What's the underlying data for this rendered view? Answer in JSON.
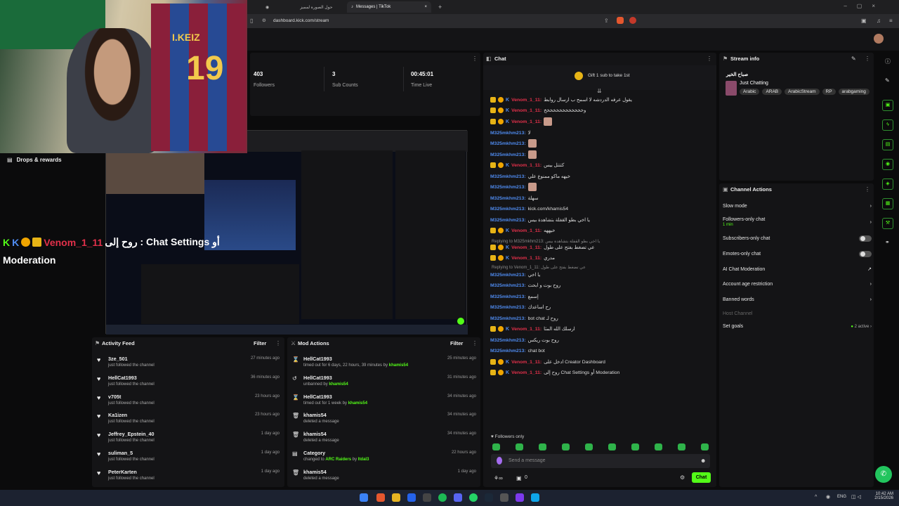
{
  "browser": {
    "tabs": [
      {
        "label": "حول الصورة لمميز"
      },
      {
        "label": "Messages | TikTok"
      }
    ],
    "url": "dashboard.kick.com/stream",
    "time": "10:42 AM",
    "date": "2/15/2026",
    "lang": "ENG"
  },
  "stats": {
    "followers_value": "403",
    "followers_label": "Followers",
    "subs_value": "3",
    "subs_label": "Sub Counts",
    "time_value": "00:45:01",
    "time_label": "Time Live"
  },
  "overlay": {
    "drops": "Drops & rewards",
    "big_user": "Venom_1_11",
    "big_msg": "روح إلى : Chat Settings أو",
    "moderation": "Moderation"
  },
  "chat": {
    "title": "Chat",
    "gift_text": "Gift 1 sub to take 1st",
    "followers_only": "Followers only",
    "send_placeholder": "Send a message",
    "send_button": "Chat",
    "counter": "0",
    "messages": [
      {
        "user": "Venom_1_11:",
        "type": "red",
        "text": "يقول عرفه الدردشه لا اسمح ب ارسال روابط"
      },
      {
        "user": "Venom_1_11:",
        "type": "red",
        "text": "وخخخخخخخخخخخخخ"
      },
      {
        "user": "Venom_1_11:",
        "type": "red",
        "text": "",
        "emote": true
      },
      {
        "user": "M325mkhm213:",
        "type": "blue",
        "text": "لا"
      },
      {
        "user": "M325mkhm213:",
        "type": "blue",
        "text": "",
        "emote": true
      },
      {
        "user": "M325mkhm213:",
        "type": "blue",
        "text": "",
        "emote": true
      },
      {
        "user": "Venom_1_11:",
        "type": "red",
        "text": "كتتتل بيس"
      },
      {
        "user": "M325mkhm213:",
        "type": "blue",
        "text": "خيهه ماكو ممنوع علي"
      },
      {
        "user": "M325mkhm213:",
        "type": "blue",
        "text": "",
        "emote": true
      },
      {
        "user": "M325mkhm213:",
        "type": "blue",
        "text": "سهلة"
      },
      {
        "user": "M325mkhm213:",
        "type": "blue",
        "text": "kick.com/khamis54"
      },
      {
        "user": "M325mkhm213:",
        "type": "blue",
        "text": "يا اخي بطو القفلة بتشاهدة بيس"
      },
      {
        "user": "Venom_1_11:",
        "type": "red",
        "text": "خيههه"
      },
      {
        "user": "Venom_1_11:",
        "type": "red",
        "text": "عي تضغط بفتح على طول"
      },
      {
        "user": "Venom_1_11:",
        "type": "red",
        "text": "مدري"
      },
      {
        "user": "M325mkhm213:",
        "type": "blue",
        "text": "يا اخي"
      },
      {
        "user": "M325mkhm213:",
        "type": "blue",
        "text": "روح بوت و ابحث"
      },
      {
        "user": "M325mkhm213:",
        "type": "blue",
        "text": "إسمع"
      },
      {
        "user": "M325mkhm213:",
        "type": "blue",
        "text": "رح اساعدك"
      },
      {
        "user": "M325mkhm213:",
        "type": "blue",
        "text": "bot chat روح لـ"
      },
      {
        "user": "Venom_1_11:",
        "type": "red",
        "text": "ارسلك الله المثا"
      },
      {
        "user": "M325mkhm213:",
        "type": "blue",
        "text": "روح بوت ريكس"
      },
      {
        "user": "M325mkhm213:",
        "type": "blue",
        "text": "chat bot"
      },
      {
        "user": "Venom_1_11:",
        "type": "red",
        "text": "ادخل على Creator Dashboard"
      },
      {
        "user": "Venom_1_11:",
        "type": "red",
        "text": "روح إلى Chat Settings أو Moderation"
      }
    ],
    "reply1": "Replying to M325mkhm213: يا اخي بطو القفلة بتشاهدة بيس",
    "reply2": "Replying to Venom_1_11: عي تضغط بفتح على طول"
  },
  "stream_info": {
    "title": "Stream info",
    "stream_title": "صباح الخير",
    "category": "Just Chatting",
    "tags": [
      "Arabic",
      "ARAB",
      "ArabicStream",
      "RP",
      "arabgaming"
    ]
  },
  "channel_actions": {
    "title": "Channel Actions",
    "items": [
      {
        "label": "Slow mode"
      },
      {
        "label": "Followers-only chat",
        "sub": "1 min"
      },
      {
        "label": "Subscribers-only chat"
      },
      {
        "label": "Emotes-only chat"
      },
      {
        "label": "AI Chat Moderation"
      },
      {
        "label": "Account age restriction"
      },
      {
        "label": "Banned words"
      },
      {
        "label": "Host Channel"
      },
      {
        "label": "Set goals",
        "status": "2 active"
      }
    ]
  },
  "activity_feed": {
    "title": "Activity Feed",
    "filter": "Filter",
    "items": [
      {
        "name": "3ze_501",
        "sub": "just followed the channel",
        "time": "27 minutes ago"
      },
      {
        "name": "HellCat1993",
        "sub": "just followed the channel",
        "time": "36 minutes ago"
      },
      {
        "name": "v705t",
        "sub": "just followed the channel",
        "time": "23 hours ago"
      },
      {
        "name": "Ka1izen",
        "sub": "just followed the channel",
        "time": "23 hours ago"
      },
      {
        "name": "Jeffrey_Epstein_40",
        "sub": "just followed the channel",
        "time": "1 day ago"
      },
      {
        "name": "suliman_5",
        "sub": "just followed the channel",
        "time": "1 day ago"
      },
      {
        "name": "PeterKarten",
        "sub": "just followed the channel",
        "time": "1 day ago"
      }
    ]
  },
  "mod_actions": {
    "title": "Mod Actions",
    "filter": "Filter",
    "items": [
      {
        "name": "HellCat1993",
        "sub": "timed out for 6 days, 22 hours, 39 minutes by",
        "by": "khamis54",
        "time": "25 minutes ago",
        "icon": "hourglass-icon"
      },
      {
        "name": "HellCat1993",
        "sub": "unbanned by",
        "by": "khamis54",
        "time": "31 minutes ago",
        "icon": "undo-icon"
      },
      {
        "name": "HellCat1993",
        "sub": "timed out for 1 week by",
        "by": "khamis54",
        "time": "34 minutes ago",
        "icon": "hourglass-icon"
      },
      {
        "name": "khamis54",
        "sub": "deleted a message",
        "by": "",
        "time": "34 minutes ago",
        "icon": "trash-icon"
      },
      {
        "name": "khamis54",
        "sub": "deleted a message",
        "by": "",
        "time": "34 minutes ago",
        "icon": "trash-icon"
      },
      {
        "name": "Category",
        "sub": "changed to",
        "by": "ARC Raiders",
        "by2": "by",
        "by3": "Itdal3",
        "time": "22 hours ago",
        "icon": "category-icon"
      },
      {
        "name": "khamis54",
        "sub": "deleted a message",
        "by": "",
        "time": "1 day ago",
        "icon": "trash-icon"
      }
    ]
  }
}
